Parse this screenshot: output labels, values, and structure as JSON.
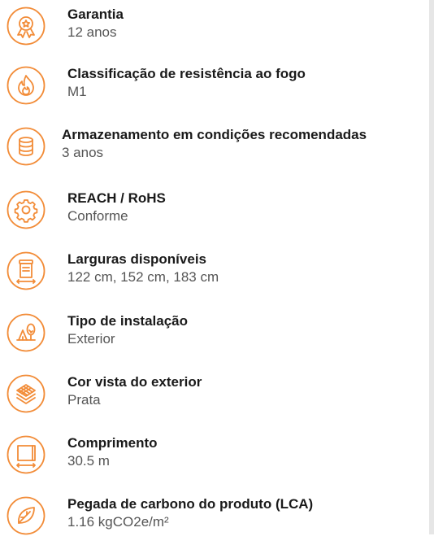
{
  "accent_color": "#f28c38",
  "specs": [
    {
      "icon": "award-badge-icon",
      "title": "Garantia",
      "value": "12 anos"
    },
    {
      "icon": "flame-icon",
      "title": "Classificação de resistência ao fogo",
      "value": "M1"
    },
    {
      "icon": "database-icon",
      "title": "Armazenamento em condições recomendadas",
      "value": "3 anos"
    },
    {
      "icon": "gear-icon",
      "title": "REACH / RoHS",
      "value": "Conforme"
    },
    {
      "icon": "roll-width-icon",
      "title": "Larguras disponíveis",
      "value": "122 cm, 152 cm, 183 cm"
    },
    {
      "icon": "outdoor-tree-icon",
      "title": "Tipo de instalação",
      "value": "Exterior"
    },
    {
      "icon": "layers-icon",
      "title": "Cor vista do exterior",
      "value": "Prata"
    },
    {
      "icon": "length-icon",
      "title": "Comprimento",
      "value": "30.5 m"
    },
    {
      "icon": "leaf-icon",
      "title": "Pegada de carbono do produto (LCA)",
      "value": "1.16 kgCO2e/m²"
    }
  ]
}
